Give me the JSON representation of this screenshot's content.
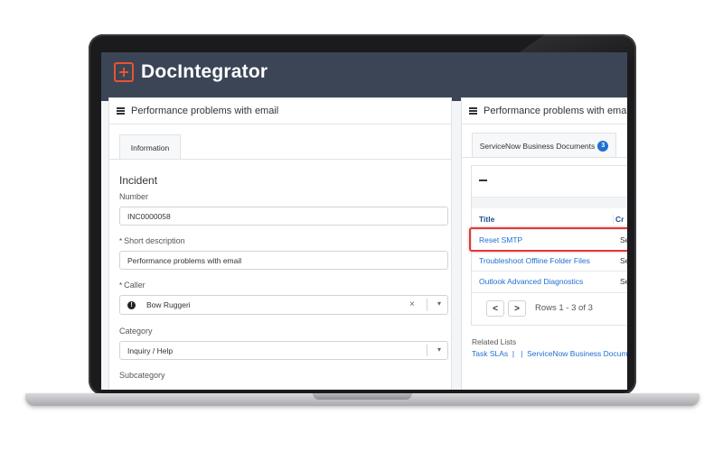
{
  "app": {
    "brand": "DocIntegrator"
  },
  "form_panel": {
    "title": "Performance problems with email",
    "tab": "Information",
    "section_title": "Incident",
    "fields": {
      "number_label": "Number",
      "number_value": "INC0000058",
      "short_desc_label": "Short description",
      "short_desc_value": "Performance problems with email",
      "caller_label": "Caller",
      "caller_value": "Bow Ruggeri",
      "category_label": "Category",
      "category_value": "Inquiry / Help",
      "subcategory_label": "Subcategory"
    },
    "required_mark": "*",
    "clear_glyph": "×",
    "dropdown_glyph": "▾"
  },
  "docs_panel": {
    "title": "Performance problems with email",
    "tab": "ServiceNow Business Documents",
    "tab_badge": "3",
    "table": {
      "columns": [
        "Title",
        "Cr"
      ],
      "rows": [
        {
          "title": "Reset SMTP",
          "col2": "Se"
        },
        {
          "title": "Troubleshoot Offline Folder Files",
          "col2": "Se"
        },
        {
          "title": "Outlook Advanced Diagnostics",
          "col2": "Se"
        }
      ]
    },
    "pagination": {
      "prev": "<",
      "next": ">",
      "summary": "Rows 1 - 3 of 3"
    },
    "related": {
      "label": "Related Lists",
      "links": "Task SLAs  |   |  ServiceNow Business Docum"
    }
  },
  "colors": {
    "header": "#3b4556",
    "accent": "#e8542f",
    "link": "#1f6fd1",
    "highlight": "#e03a3a"
  }
}
